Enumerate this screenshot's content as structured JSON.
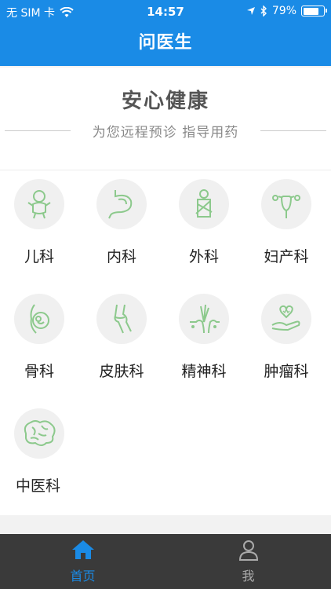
{
  "status": {
    "carrier": "无 SIM 卡",
    "time": "14:57",
    "battery": "79%",
    "battery_level": 0.79
  },
  "nav": {
    "title": "问医生"
  },
  "banner": {
    "title": "安心健康",
    "subtitle": "为您远程预诊 指导用药"
  },
  "departments": [
    {
      "label": "儿科",
      "icon": "baby-icon"
    },
    {
      "label": "内科",
      "icon": "stomach-icon"
    },
    {
      "label": "外科",
      "icon": "surgery-arm-sling-icon"
    },
    {
      "label": "妇产科",
      "icon": "uterus-icon"
    },
    {
      "label": "骨科",
      "icon": "pregnancy-icon"
    },
    {
      "label": "皮肤科",
      "icon": "bone-joint-icon"
    },
    {
      "label": "精神科",
      "icon": "skin-hair-icon"
    },
    {
      "label": "肿瘤科",
      "icon": "hand-heart-icon"
    },
    {
      "label": "中医科",
      "icon": "brain-icon"
    }
  ],
  "tabs": [
    {
      "label": "首页",
      "icon": "home-icon",
      "active": true
    },
    {
      "label": "我",
      "icon": "user-icon",
      "active": false
    }
  ],
  "colors": {
    "primary": "#1a8be6",
    "icon_green": "#8cc98c",
    "tab_bg": "#3a3a3a"
  }
}
